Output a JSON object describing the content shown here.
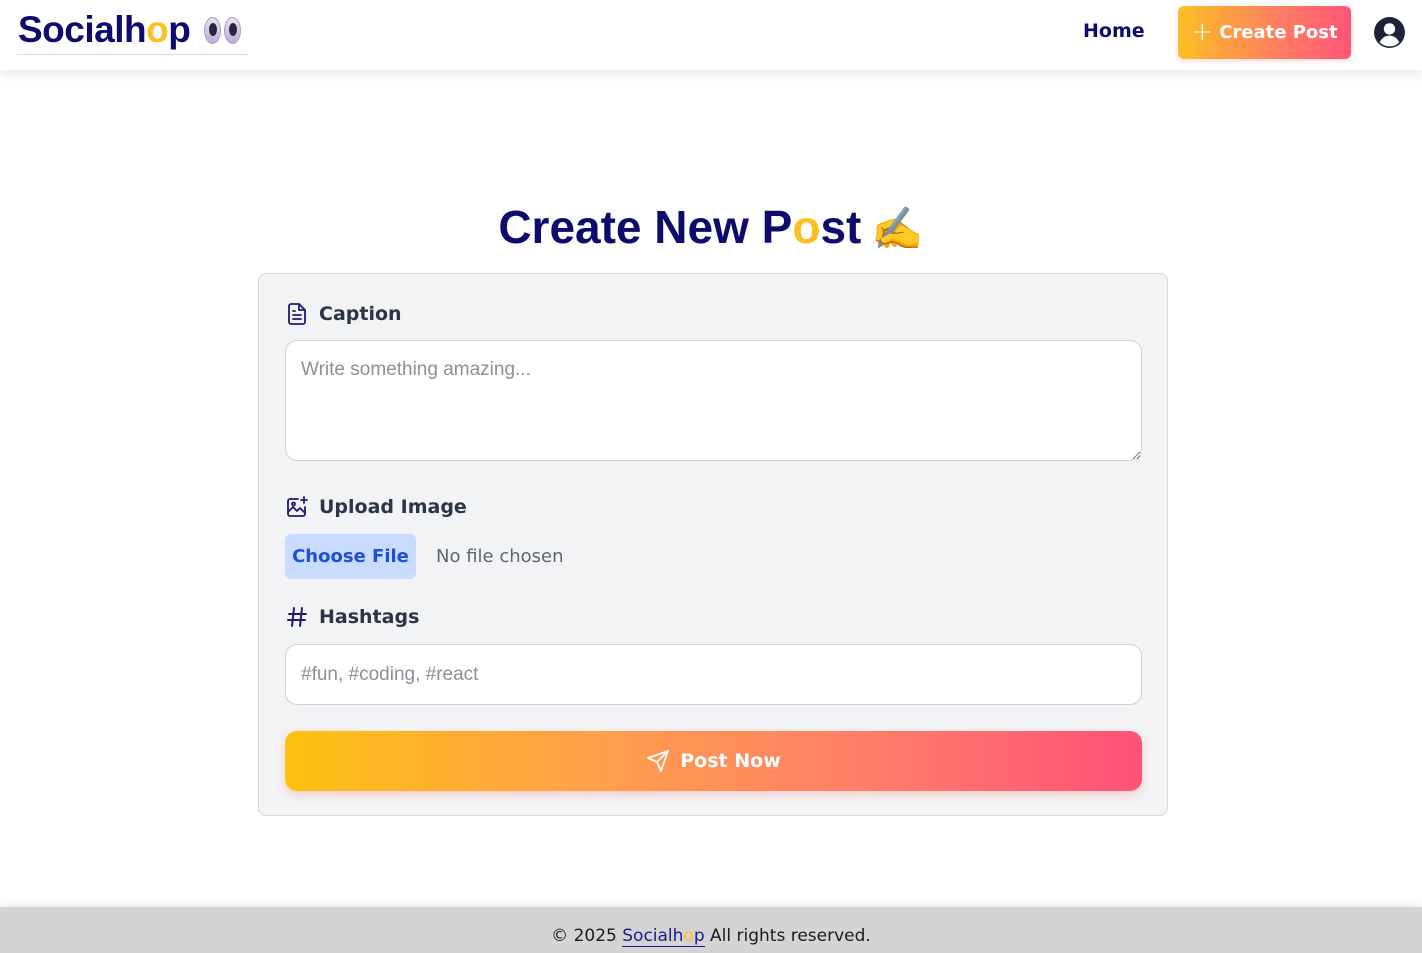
{
  "navbar": {
    "brand_prefix": "Socialh",
    "brand_highlight": "o",
    "brand_suffix": "p",
    "brand_icon": "eyes-emoji",
    "home_label": "Home",
    "create_label": "Create Post",
    "create_icon": "plus-icon",
    "avatar_icon": "user-circle-icon"
  },
  "page": {
    "title_prefix": "Create New P",
    "title_highlight": "o",
    "title_suffix": "st",
    "title_emoji": "✍️"
  },
  "form": {
    "caption": {
      "label": "Caption",
      "icon": "document-icon",
      "placeholder": "Write something amazing...",
      "value": ""
    },
    "upload": {
      "label": "Upload Image",
      "icon": "image-plus-icon",
      "button_label": "Choose File",
      "status": "No file chosen"
    },
    "hashtags": {
      "label": "Hashtags",
      "icon": "hash-icon",
      "placeholder": "#fun, #coding, #react",
      "value": ""
    },
    "submit": {
      "label": "Post Now",
      "icon": "send-icon"
    }
  },
  "footer": {
    "copyright": "© 2025",
    "brand_prefix": "Socialh",
    "brand_highlight": "o",
    "brand_suffix": "p",
    "rights": "All rights reserved."
  },
  "colors": {
    "brand_navy": "#0d0b6e",
    "brand_yellow": "#fbbf24",
    "gradient_start": "#fcc110",
    "gradient_end": "#ff5177",
    "file_button_bg": "#c9dcff"
  }
}
